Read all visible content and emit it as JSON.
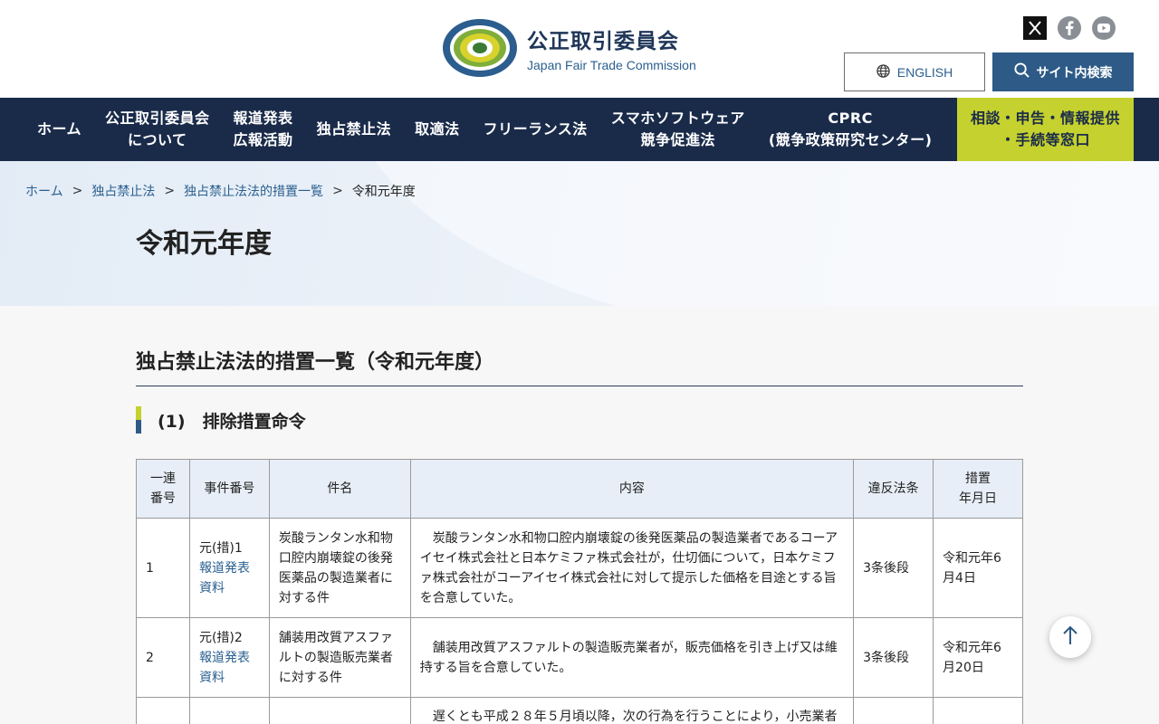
{
  "header": {
    "logo_ja": "公正取引委員会",
    "logo_en": "Japan Fair Trade Commission",
    "english_label": "ENGLISH",
    "search_label": "サイト内検索",
    "social": [
      "x-icon",
      "facebook-icon",
      "youtube-icon"
    ]
  },
  "nav": {
    "items": [
      "ホーム",
      "公正取引委員会\nについて",
      "報道発表\n広報活動",
      "独占禁止法",
      "取適法",
      "フリーランス法",
      "スマホソフトウェア\n競争促進法",
      "CPRC\n(競争政策研究センター)"
    ],
    "consult": "相談・申告・情報提供\n・手続等窓口"
  },
  "breadcrumb": {
    "home": "ホーム",
    "sep": ">",
    "law": "独占禁止法",
    "list": "独占禁止法法的措置一覧",
    "current": "令和元年度"
  },
  "page_title": "令和元年度",
  "section_title": "独占禁止法法的措置一覧（令和元年度）",
  "sub_title": "(1)　排除措置命令",
  "table": {
    "headers": [
      "一連\n番号",
      "事件番号",
      "件名",
      "内容",
      "違反法条",
      "措置\n年月日"
    ],
    "rows": [
      {
        "no": "1",
        "case": "元(措)1",
        "link": "報道発表\n資料",
        "title": "炭酸ランタン水和物口腔内崩壊錠の後発医薬品の製造業者に対する件",
        "content": "　炭酸ランタン水和物口腔内崩壊錠の後発医薬品の製造業者であるコーアイセイ株式会社と日本ケミファ株式会社が，仕切価について，日本ケミファ株式会社がコーアイセイ株式会社に対して提示した価格を目途とする旨を合意していた。",
        "article": "3条後段",
        "date": "令和元年6月4日"
      },
      {
        "no": "2",
        "case": "元(措)2",
        "link": "報道発表\n資料",
        "title": "舗装用改質アスファルトの製造販売業者に対する件",
        "content": "　舗装用改質アスファルトの製造販売業者が，販売価格を引き上げ又は維持する旨を合意していた。",
        "article": "3条後段",
        "date": "令和元年6月20日"
      },
      {
        "no": "",
        "case": "",
        "link": "",
        "title": "",
        "content": "　遅くとも平成２８年５月頃以降，次の行為を行うことにより，小売業者",
        "article": "",
        "date": ""
      }
    ]
  },
  "colors": {
    "navy": "#1a2b4a",
    "accent": "#c5d12e",
    "blue": "#2d5a86"
  }
}
